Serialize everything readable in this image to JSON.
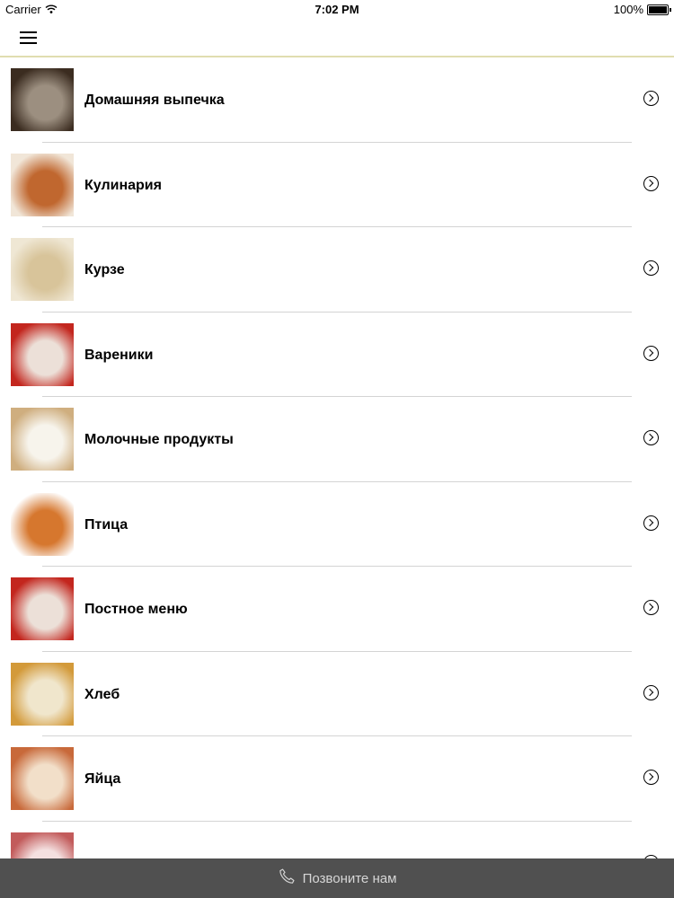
{
  "status_bar": {
    "carrier": "Carrier",
    "time": "7:02 PM",
    "battery": "100%"
  },
  "nav": {
    "menu_icon": "hamburger-menu-icon"
  },
  "categories": [
    {
      "label": "Домашняя выпечка",
      "thumb_colors": [
        "#3b2c20",
        "#9c8f80"
      ]
    },
    {
      "label": "Кулинария",
      "thumb_colors": [
        "#f1e6d8",
        "#c0672f"
      ]
    },
    {
      "label": "Курзе",
      "thumb_colors": [
        "#efe7d4",
        "#d8c49a"
      ]
    },
    {
      "label": "Вареники",
      "thumb_colors": [
        "#c3261e",
        "#ece0d8"
      ]
    },
    {
      "label": "Молочные продукты",
      "thumb_colors": [
        "#cfae7f",
        "#f7f4ec"
      ]
    },
    {
      "label": "Птица",
      "thumb_colors": [
        "#ffffff",
        "#d6772e"
      ]
    },
    {
      "label": "Постное меню",
      "thumb_colors": [
        "#c3261e",
        "#ece0d8"
      ]
    },
    {
      "label": "Хлеб",
      "thumb_colors": [
        "#d39a3a",
        "#f0e6cc"
      ]
    },
    {
      "label": "Яйца",
      "thumb_colors": [
        "#c8693a",
        "#f2dfc9"
      ]
    },
    {
      "label": "",
      "thumb_colors": [
        "#c25b5b",
        "#f4e0e0"
      ]
    }
  ],
  "footer": {
    "label": "Позвоните нам",
    "icon": "phone-icon"
  },
  "colors": {
    "footer_bg": "#505050",
    "nav_border": "#e0ddb0",
    "divider": "#d4d4d4"
  }
}
